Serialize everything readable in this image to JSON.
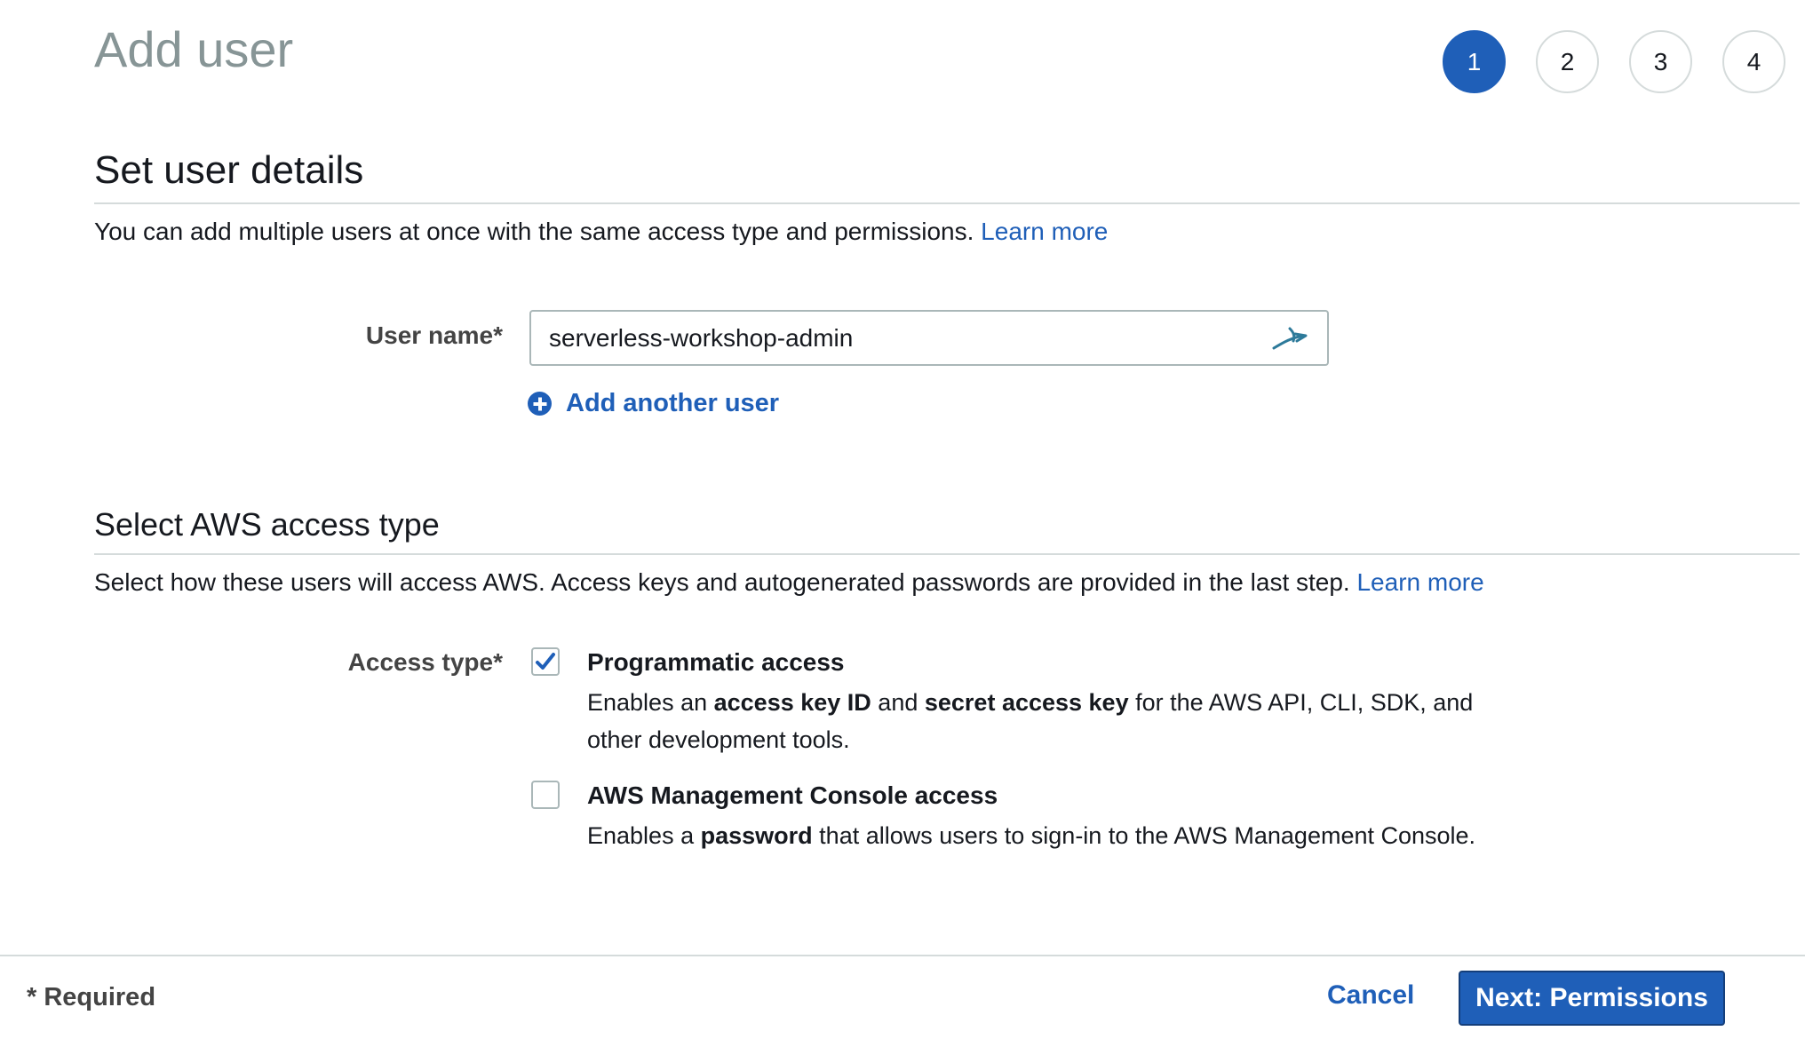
{
  "page": {
    "title": "Add user"
  },
  "steps": [
    {
      "label": "1",
      "active": true
    },
    {
      "label": "2",
      "active": false
    },
    {
      "label": "3",
      "active": false
    },
    {
      "label": "4",
      "active": false
    }
  ],
  "user_details": {
    "title": "Set user details",
    "description": "You can add multiple users at once with the same access type and permissions.",
    "learn_more": "Learn more",
    "user_name_label": "User name*",
    "user_name_value": "serverless-workshop-admin",
    "add_another_label": "Add another user"
  },
  "access_type": {
    "title": "Select AWS access type",
    "description": "Select how these users will access AWS. Access keys and autogenerated passwords are provided in the last step.",
    "learn_more": "Learn more",
    "label": "Access type*",
    "options": [
      {
        "title": "Programmatic access",
        "checked": true,
        "desc_prefix": "Enables an",
        "desc_bold_1": "access key ID",
        "desc_mid": "and",
        "desc_bold_2": "secret access key",
        "desc_suffix": "for the AWS API, CLI, SDK, and other development tools."
      },
      {
        "title": "AWS Management Console access",
        "checked": false,
        "desc_prefix": "Enables a",
        "desc_bold_1": "password",
        "desc_suffix": "that allows users to sign-in to the AWS Management Console."
      }
    ]
  },
  "footer": {
    "required_note": "* Required",
    "cancel_label": "Cancel",
    "next_label": "Next: Permissions"
  },
  "colors": {
    "accent": "#1f5fb8",
    "title_gray": "#879596",
    "border": "#aab7b8"
  }
}
